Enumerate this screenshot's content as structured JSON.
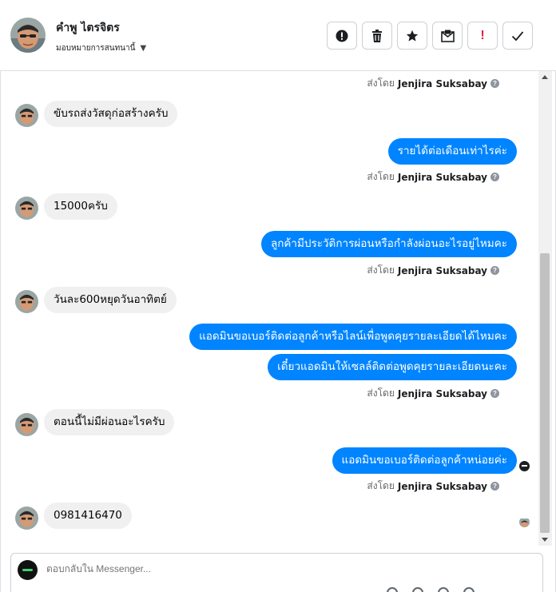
{
  "header": {
    "contact_name": "คำพู ไตรจิตร",
    "assign_label": "มอบหมายการสนทนานี้",
    "actions": [
      {
        "name": "mark-spam-button",
        "icon": "alert-circle-icon"
      },
      {
        "name": "delete-button",
        "icon": "trash-icon"
      },
      {
        "name": "star-button",
        "icon": "star-icon"
      },
      {
        "name": "mark-unread-button",
        "icon": "envelope-icon"
      },
      {
        "name": "follow-up-button",
        "icon": "exclamation-icon",
        "text": "!"
      },
      {
        "name": "mark-done-button",
        "icon": "check-icon"
      }
    ]
  },
  "conversation": {
    "sender_prefix": "ส่งโดย",
    "sender_name": "Jenjira Suksabay",
    "help_glyph": "?",
    "messages": [
      {
        "dir": "in",
        "text": "ขับรถส่งวัสดุก่อสร้างครับ"
      },
      {
        "dir": "out",
        "text": "รายได้ต่อเดือนเท่าไรค่ะ"
      },
      {
        "dir": "in",
        "text": "15000ครับ"
      },
      {
        "dir": "out",
        "text": "ลูกค้ามีประวัติการผ่อนหรือกำลังผ่อนอะไรอยู่ไหมคะ"
      },
      {
        "dir": "in",
        "text": "วันละ600หยุดวันอาทิตย์"
      },
      {
        "dir": "out",
        "text": "แอดมินขอเบอร์ติดต่อลูกค้าหรือไลน์เพื่อพูดคุยรายละเอียดได้ไหมคะ"
      },
      {
        "dir": "out",
        "text": "เดี๋ยวแอดมินให้เซลล์ติดต่อพูดคุยรายละเอียดนะคะ"
      },
      {
        "dir": "in",
        "text": "ตอนนี้ไม่มีผ่อนอะไรครับ"
      },
      {
        "dir": "out",
        "text": "แอดมินขอเบอร์ติดต่อลูกค้าหน่อยค่ะ"
      },
      {
        "dir": "in",
        "text": "0981416470"
      }
    ]
  },
  "composer": {
    "placeholder": "ตอบกลับใน Messenger..."
  },
  "colors": {
    "outgoing_bubble": "#0084ff",
    "incoming_bubble": "#f0f0f0",
    "follow_up_red": "#e41e3f"
  }
}
